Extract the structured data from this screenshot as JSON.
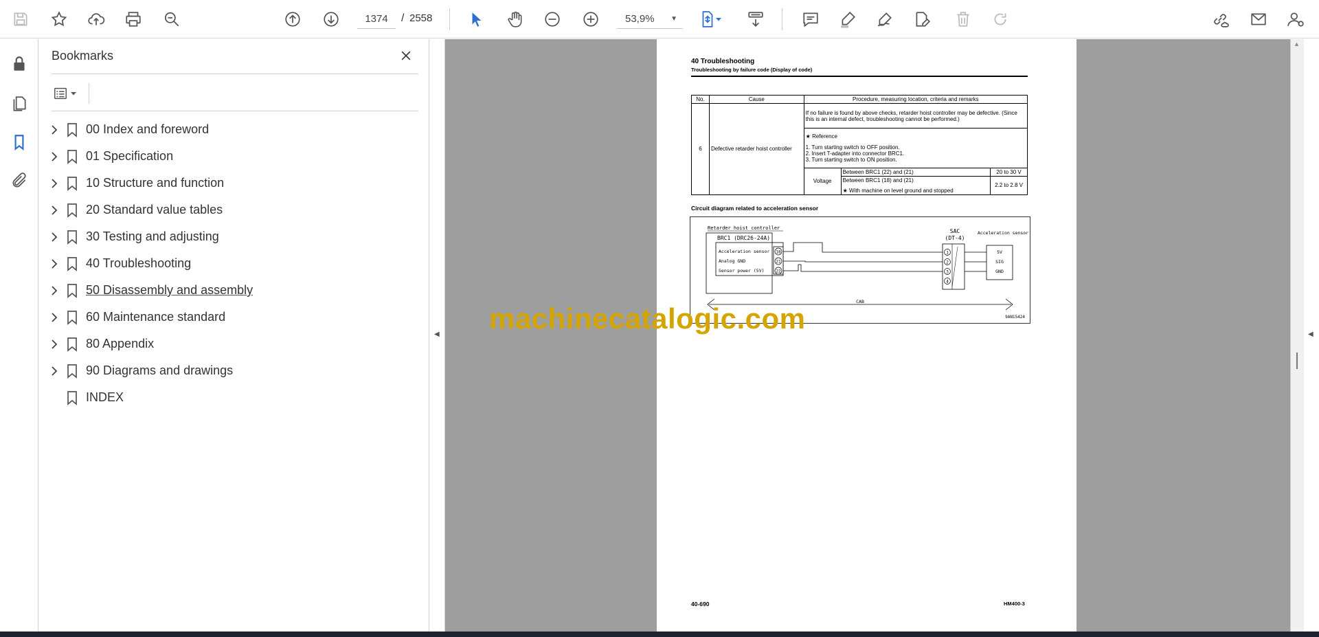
{
  "toolbar": {
    "current_page": "1374",
    "page_separator": "/",
    "total_pages": "2558",
    "zoom": "53,9%"
  },
  "bookmarks_panel": {
    "title": "Bookmarks",
    "items": [
      {
        "label": "00 Index and foreword",
        "expandable": true
      },
      {
        "label": "01 Specification",
        "expandable": true
      },
      {
        "label": "10 Structure and function",
        "expandable": true
      },
      {
        "label": "20 Standard value tables",
        "expandable": true
      },
      {
        "label": "30 Testing and adjusting",
        "expandable": true
      },
      {
        "label": "40 Troubleshooting",
        "expandable": true
      },
      {
        "label": "50 Disassembly and assembly",
        "expandable": true
      },
      {
        "label": "60 Maintenance standard",
        "expandable": true
      },
      {
        "label": "80 Appendix",
        "expandable": true
      },
      {
        "label": "90 Diagrams and drawings",
        "expandable": true
      },
      {
        "label": "INDEX",
        "expandable": false
      }
    ]
  },
  "document": {
    "heading": "40 Troubleshooting",
    "subheading": "Troubleshooting by failure code (Display of code)",
    "table": {
      "col_no": "No.",
      "col_cause": "Cause",
      "col_procedure": "Procedure, measuring location, criteria and remarks",
      "row_no": "6",
      "row_cause": "Defective retarder hoist controller",
      "note1": "If no failure is found by above checks, retarder hoist controller may be defective. (Since this is an internal defect, troubleshooting cannot be performed.)",
      "reference": "★  Reference",
      "step1": "1.  Turn starting switch to OFF position.",
      "step2": "2.  Insert T-adapter into connector BRC1.",
      "step3": "3.  Turn starting switch to ON position.",
      "voltage_label": "Voltage",
      "measure1": "Between BRC1 (22) and (21)",
      "value1": "20 to 30 V",
      "measure2": "Between BRC1 (18) and (21)",
      "condition2": "★  With machine on level ground and stopped",
      "value2": "2.2 to 2.8 V"
    },
    "circuit_caption": "Circuit diagram related to acceleration sensor",
    "circuit": {
      "controller_title": "Retarder hoist controller",
      "connector": "BRC1 (DRC26-24A)",
      "pin_labels": [
        "Acceleration sensor",
        "Analog GND",
        "Sensor power (5V)"
      ],
      "pin_numbers": [
        "18",
        "21",
        "22"
      ],
      "sensor_connector_name": "SAC",
      "sensor_connector_type": "(DT-4)",
      "sensor_pins": [
        "1",
        "2",
        "3",
        "4"
      ],
      "sensor_title": "Acceleration sensor",
      "sensor_terminals": [
        "5V",
        "SIG",
        "GND"
      ],
      "harness": "CAB",
      "drawing_no": "9AN15424"
    },
    "footer_page": "40-690",
    "footer_model": "HM400-3"
  },
  "watermark": "machinecatalogic.com"
}
